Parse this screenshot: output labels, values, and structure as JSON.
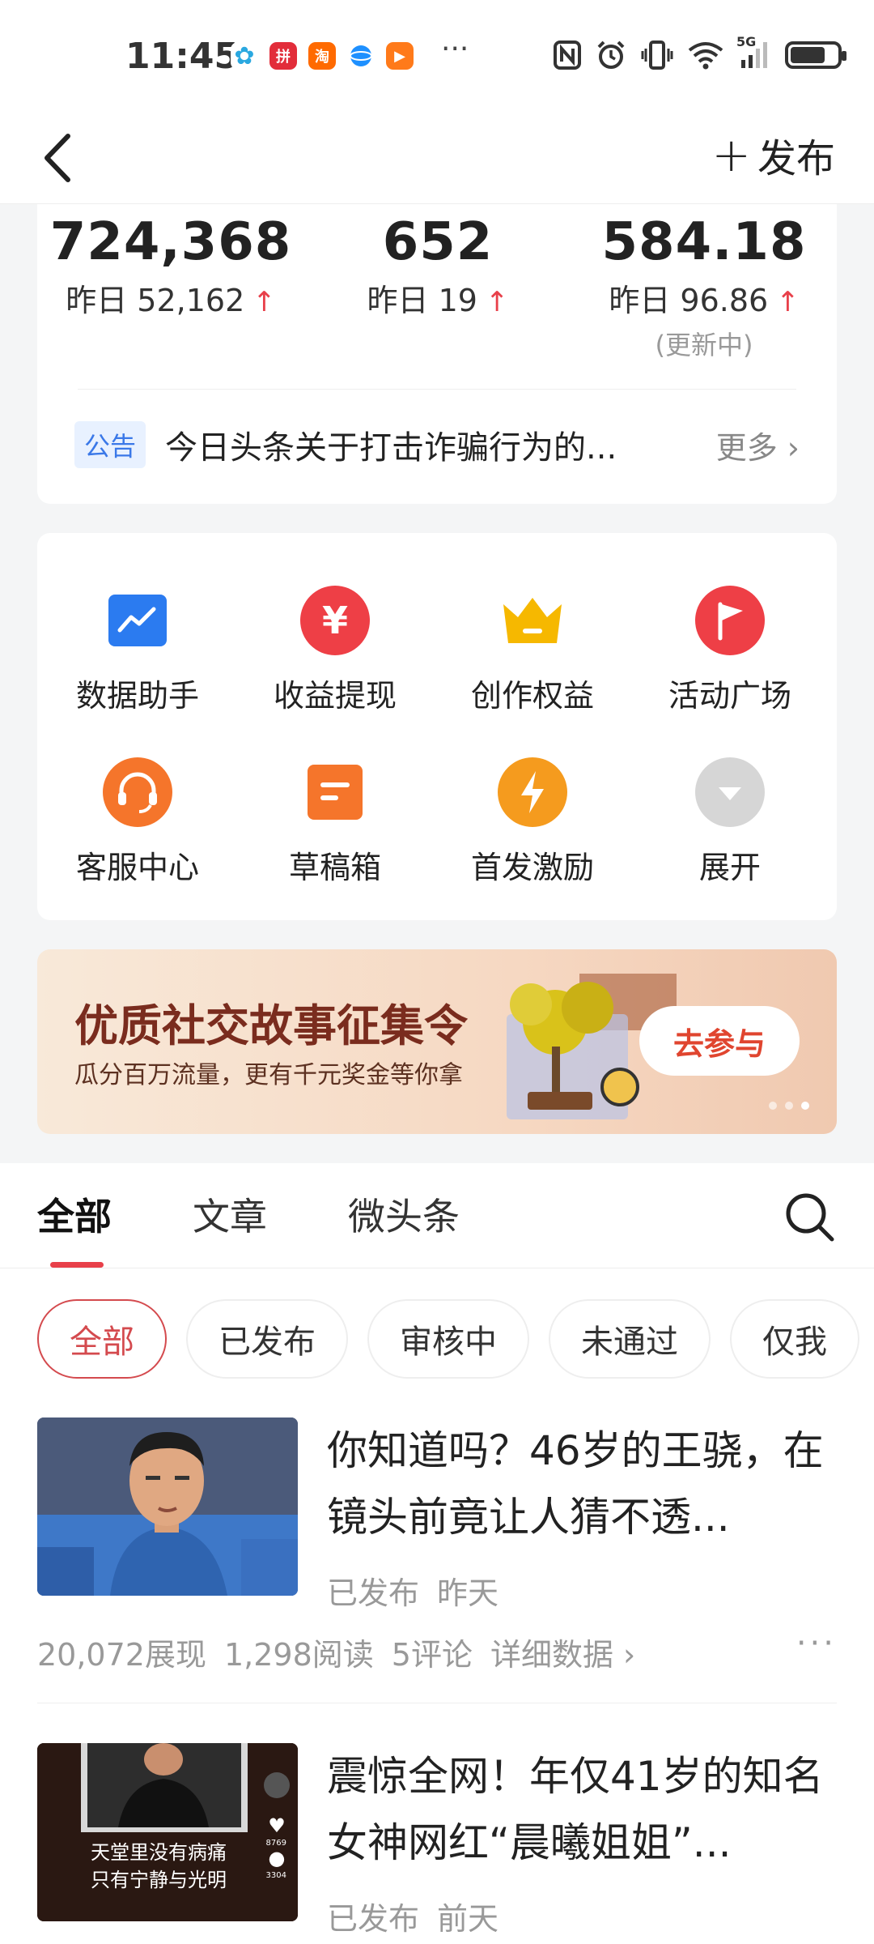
{
  "status_bar": {
    "time": "11:45",
    "network": "5G",
    "battery_level": 0.75,
    "apps": [
      {
        "name": "pinwheel-app-icon",
        "color": "#2aa8e0",
        "glyph": "✿"
      },
      {
        "name": "pinduoduo-app-icon",
        "color": "#e22d3a",
        "glyph": "拼"
      },
      {
        "name": "taobao-app-icon",
        "color": "#ff6a00",
        "glyph": "淘"
      },
      {
        "name": "browser-app-icon",
        "color": "#1e90ff",
        "glyph": "●"
      },
      {
        "name": "video-app-icon",
        "color": "#ff7a1a",
        "glyph": "▶"
      }
    ],
    "more": "···"
  },
  "header": {
    "publish_label": "发布"
  },
  "stats": [
    {
      "value": "724,368",
      "yesterday": "昨日 52,162",
      "arrow": "↑",
      "note": ""
    },
    {
      "value": "652",
      "yesterday": "昨日 19",
      "arrow": "↑",
      "note": ""
    },
    {
      "value": "584.18",
      "yesterday": "昨日 96.86",
      "arrow": "↑",
      "note": "(更新中)"
    }
  ],
  "notice": {
    "tag": "公告",
    "text": "今日头条关于打击诈骗行为的...",
    "more": "更多"
  },
  "tools": [
    {
      "label": "数据助手",
      "icon": "chart-icon",
      "color": "#2b7bf0"
    },
    {
      "label": "收益提现",
      "icon": "yuan-icon",
      "color": "#ee3f46"
    },
    {
      "label": "创作权益",
      "icon": "crown-icon",
      "color": "#f6b800"
    },
    {
      "label": "活动广场",
      "icon": "flag-icon",
      "color": "#ee3f46"
    },
    {
      "label": "客服中心",
      "icon": "headset-icon",
      "color": "#f5752b"
    },
    {
      "label": "草稿箱",
      "icon": "draft-icon",
      "color": "#f5752b"
    },
    {
      "label": "首发激励",
      "icon": "lightning-icon",
      "color": "#f59b1e"
    },
    {
      "label": "展开",
      "icon": "expand-icon",
      "color": "#cfcfcf"
    }
  ],
  "banner": {
    "title": "优质社交故事征集令",
    "subtitle": "瓜分百万流量，更有千元奖金等你拿",
    "button": "去参与"
  },
  "tabs": [
    "全部",
    "文章",
    "微头条"
  ],
  "filters": [
    "全部",
    "已发布",
    "审核中",
    "未通过",
    "仅我"
  ],
  "articles": [
    {
      "title": "你知道吗？46岁的王骁，在镜头前竟让人猜不透...",
      "status": "已发布",
      "time": "昨天",
      "views": "20,072展现",
      "reads": "1,298阅读",
      "comments": "5评论",
      "detail": "详细数据 ›",
      "more": "···"
    },
    {
      "title": "震惊全网！年仅41岁的知名女神网红“晨曦姐姐”...",
      "status": "已发布",
      "time": "前天",
      "thumb_caption_1": "天堂里没有病痛",
      "thumb_caption_2": "只有宁静与光明",
      "thumb_likes": "8769",
      "thumb_comments": "3304"
    }
  ]
}
